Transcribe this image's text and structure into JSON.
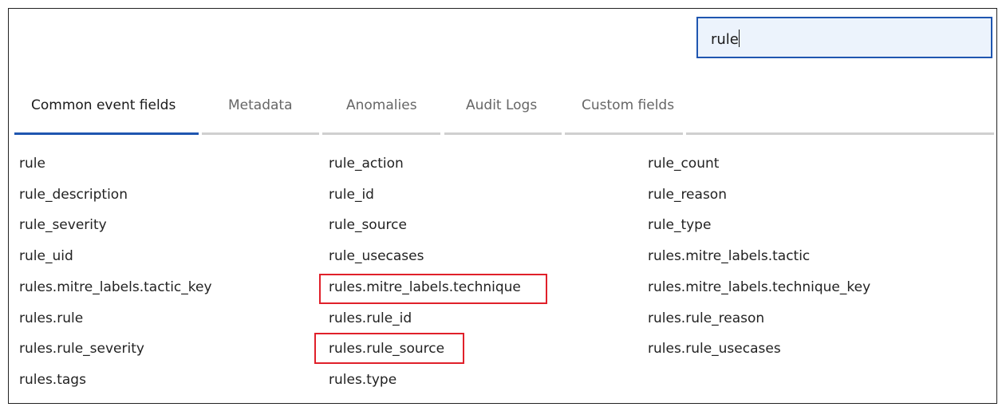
{
  "search": {
    "value": "rule"
  },
  "tabs": [
    {
      "label": "Common event fields",
      "active": true
    },
    {
      "label": "Metadata",
      "active": false
    },
    {
      "label": "Anomalies",
      "active": false
    },
    {
      "label": "Audit Logs",
      "active": false
    },
    {
      "label": "Custom fields",
      "active": false
    }
  ],
  "colors": {
    "accent": "#1f56b0",
    "highlight": "#e0202a"
  },
  "fields": [
    [
      "rule",
      "rule_action",
      "rule_count"
    ],
    [
      "rule_description",
      "rule_id",
      "rule_reason"
    ],
    [
      "rule_severity",
      "rule_source",
      "rule_type"
    ],
    [
      "rule_uid",
      "rule_usecases",
      "rules.mitre_labels.tactic"
    ],
    [
      "rules.mitre_labels.tactic_key",
      "rules.mitre_labels.technique",
      "rules.mitre_labels.technique_key"
    ],
    [
      "rules.rule",
      "rules.rule_id",
      "rules.rule_reason"
    ],
    [
      "rules.rule_severity",
      "rules.rule_source",
      "rules.rule_usecases"
    ],
    [
      "rules.tags",
      "rules.type",
      ""
    ]
  ],
  "highlighted": [
    "rules.mitre_labels.technique",
    "rules.rule_source"
  ]
}
